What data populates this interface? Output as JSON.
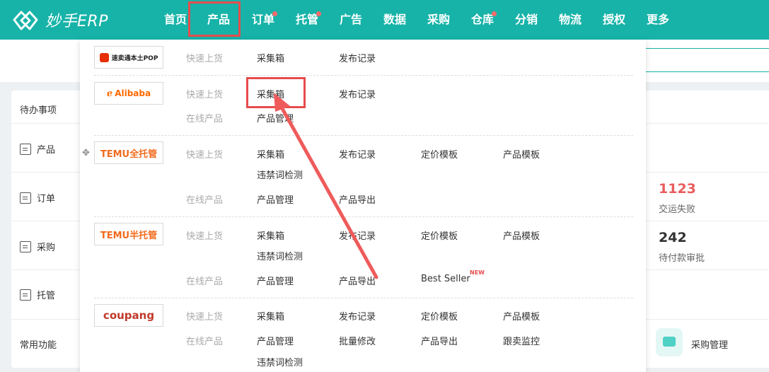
{
  "app": {
    "logo_text": "妙手ERP"
  },
  "nav": {
    "items": [
      {
        "label": "首页",
        "dot": false
      },
      {
        "label": "产品",
        "dot": false
      },
      {
        "label": "订单",
        "dot": true
      },
      {
        "label": "托管",
        "dot": true
      },
      {
        "label": "广告",
        "dot": false
      },
      {
        "label": "数据",
        "dot": false
      },
      {
        "label": "采购",
        "dot": false
      },
      {
        "label": "仓库",
        "dot": true
      },
      {
        "label": "分销",
        "dot": false
      },
      {
        "label": "物流",
        "dot": false
      },
      {
        "label": "授权",
        "dot": false
      },
      {
        "label": "更多",
        "dot": false
      }
    ],
    "active": "产品"
  },
  "sidebar": {
    "title": "待办事项",
    "items": [
      "产品",
      "订单",
      "采购",
      "托管"
    ],
    "common": "常用功能"
  },
  "stats": [
    {
      "value": "1123",
      "label": "交运失败",
      "color": "#e85d5d"
    },
    {
      "value": "242",
      "label": "待付款审批",
      "color": "#333333"
    }
  ],
  "quick": {
    "label": "采购管理"
  },
  "dropdown": {
    "sections": [
      {
        "brand": "速卖通本土POP",
        "rows": [
          {
            "category": "快速上货",
            "links": [
              "采集箱",
              "发布记录"
            ]
          }
        ]
      },
      {
        "brand": "Alibaba",
        "rows": [
          {
            "category": "快速上货",
            "links": [
              "采集箱",
              "发布记录"
            ]
          },
          {
            "category": "在线产品",
            "links": [
              "产品管理"
            ]
          }
        ]
      },
      {
        "brand": "TEMU全托管",
        "rows": [
          {
            "category": "快速上货",
            "links": [
              "采集箱",
              "发布记录",
              "定价模板",
              "产品模板"
            ],
            "extra": "违禁词检测"
          },
          {
            "category": "在线产品",
            "links": [
              "产品管理",
              "产品导出"
            ]
          }
        ]
      },
      {
        "brand": "TEMU半托管",
        "rows": [
          {
            "category": "快速上货",
            "links": [
              "采集箱",
              "发布记录",
              "定价模板",
              "产品模板"
            ],
            "extra": "违禁词检测"
          },
          {
            "category": "在线产品",
            "links": [
              "产品管理",
              "产品导出",
              "Best Seller"
            ],
            "badge": "NEW"
          }
        ]
      },
      {
        "brand": "coupang",
        "rows": [
          {
            "category": "快速上货",
            "links": [
              "采集箱",
              "发布记录",
              "定价模板",
              "产品模板"
            ]
          },
          {
            "category": "在线产品",
            "links": [
              "产品管理",
              "批量修改",
              "产品导出",
              "跟卖监控"
            ],
            "extra": "违禁词检测"
          }
        ]
      }
    ]
  },
  "colors": {
    "topbar": "#17b3a8",
    "highlight": "#e74c4c",
    "alibaba": "#ff6a00",
    "temu": "#f26b1d"
  }
}
